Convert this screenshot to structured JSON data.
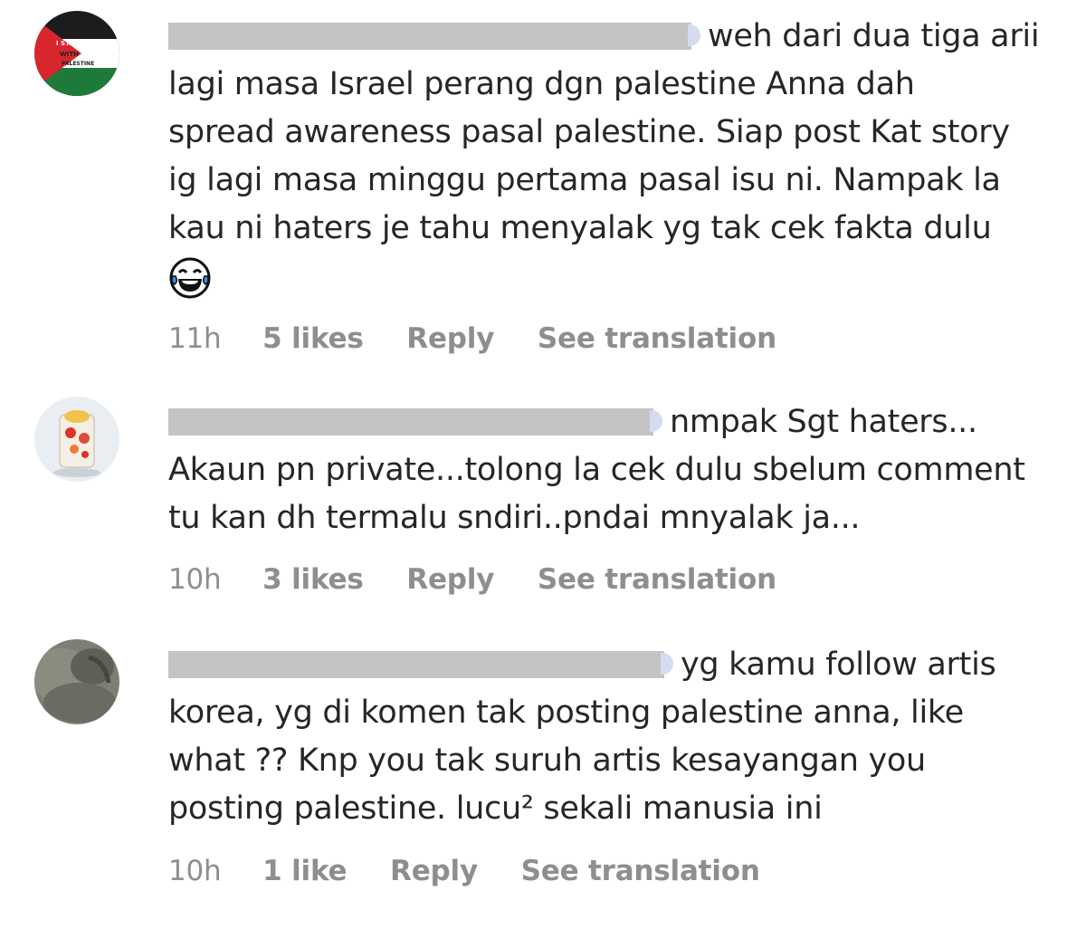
{
  "comments": [
    {
      "avatar_icon": "palestine-flag-avatar",
      "avatar_text": "I STAND WITH PALESTINE",
      "text_after_mention": "weh dari dua tiga arii",
      "lines": [
        "lagi masa Israel perang dgn palestine Anna dah",
        "spread awareness pasal palestine. Siap post Kat story",
        "ig lagi masa minggu pertama pasal isu ni. Nampak la",
        "kau ni haters je tahu menyalak yg tak cek fakta dulu"
      ],
      "emoji": "tears-of-joy-emoji",
      "time": "11h",
      "likes": "5 likes",
      "reply": "Reply",
      "translation": "See translation"
    },
    {
      "avatar_icon": "dessert-photo-avatar",
      "text_after_mention": "nmpak Sgt haters...",
      "lines": [
        "Akaun pn private...tolong la cek dulu sbelum comment",
        "tu kan dh termalu sndiri..pndai mnyalak ja..."
      ],
      "time": "10h",
      "likes": "3 likes",
      "reply": "Reply",
      "translation": "See translation"
    },
    {
      "avatar_icon": "gray-photo-avatar",
      "text_after_mention": "yg kamu follow artis",
      "lines": [
        "korea, yg di komen tak posting palestine anna, like",
        "what ?? Knp you tak suruh artis kesayangan you",
        "posting palestine. lucu² sekali manusia ini"
      ],
      "time": "10h",
      "likes": "1 like",
      "reply": "Reply",
      "translation": "See translation"
    }
  ],
  "colors": {
    "text": "#262626",
    "meta": "#8e8e8e",
    "redaction": "#c4c4c4",
    "mention": "#3b5998"
  }
}
